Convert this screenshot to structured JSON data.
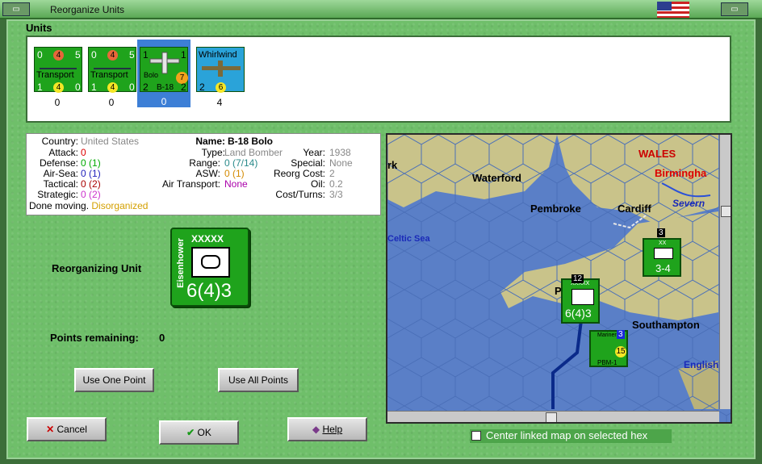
{
  "window": {
    "title": "Reorganize Units"
  },
  "units_section": {
    "label": "Units",
    "units": [
      {
        "name": "Transport",
        "top_left": "0",
        "top_mid": "4",
        "top_right": "5",
        "bot_left": "1",
        "bot_mid": "4",
        "bot_right": "0",
        "count": "0",
        "selected": false
      },
      {
        "name": "Transport",
        "top_left": "0",
        "top_mid": "4",
        "top_right": "5",
        "bot_left": "1",
        "bot_mid": "4",
        "bot_right": "0",
        "count": "0",
        "selected": false
      },
      {
        "name": "Bolo",
        "sub": "B-18",
        "top_left": "1",
        "top_right": "1",
        "mid": "7",
        "bot_left": "2",
        "bot_right": "2",
        "count": "0",
        "selected": true
      },
      {
        "name": "Whirlwind",
        "top_left": "",
        "bot_left": "2",
        "bot_mid": "6",
        "count": "4",
        "selected": false
      }
    ]
  },
  "info": {
    "country_label": "Country:",
    "country": "United States",
    "attack_label": "Attack:",
    "attack": "0",
    "defense_label": "Defense:",
    "defense": "0",
    "defense_paren": "(1)",
    "airsea_label": "Air-Sea:",
    "airsea": "0",
    "airsea_paren": "(1)",
    "tactical_label": "Tactical:",
    "tactical": "0",
    "tactical_paren": "(2)",
    "strategic_label": "Strategic:",
    "strategic": "0",
    "strategic_paren": "(2)",
    "status": "Done moving.",
    "status2": "Disorganized",
    "name_label": "Name:",
    "name": "B-18 Bolo",
    "type_label": "Type:",
    "type": "Land Bomber",
    "range_label": "Range:",
    "range": "0 (7/14)",
    "asw_label": "ASW:",
    "asw": "0 (1)",
    "airtransport_label": "Air Transport:",
    "airtransport": "None",
    "year_label": "Year:",
    "year": "1938",
    "special_label": "Special:",
    "special": "None",
    "reorgcost_label": "Reorg Cost:",
    "reorgcost": "2",
    "oil_label": "Oil:",
    "oil": "0.2",
    "costturns_label": "Cost/Turns:",
    "costturns": "3/3"
  },
  "reorganizing": {
    "label": "Reorganizing Unit",
    "leader": "Eisenhower",
    "size": "XXXXX",
    "strength": "6(4)3"
  },
  "points": {
    "label": "Points remaining:",
    "value": "0"
  },
  "buttons": {
    "use_one": "Use One Point",
    "use_all": "Use All Points",
    "cancel": "Cancel",
    "ok": "OK",
    "help": "Help"
  },
  "map": {
    "labels": {
      "wales": "WALES",
      "birmingham": "Birmingha",
      "waterford": "Waterford",
      "pembroke": "Pembroke",
      "cardiff": "Cardiff",
      "severn": "Severn",
      "celtic_sea": "Celtic Sea",
      "plymouth": "P     th",
      "southampton": "Southampton",
      "english": "English",
      "york_fragment": "rk"
    },
    "counters": [
      {
        "id": "eisenhower-map",
        "leader": "Eisenhower",
        "strength": "6(4)3",
        "size": "XXXXX",
        "stack": "12"
      },
      {
        "id": "corps-map",
        "size": "XX",
        "strength": "3-4",
        "stack": "3"
      },
      {
        "id": "pbm-map",
        "name": "Mariner",
        "sub": "PBM-1",
        "value": "15",
        "stack": "3"
      }
    ],
    "colors": {
      "sea": "#5a7fc7",
      "land": "#c9c38a"
    }
  },
  "checkbox": {
    "label": "Center linked map on selected hex",
    "checked": false
  }
}
